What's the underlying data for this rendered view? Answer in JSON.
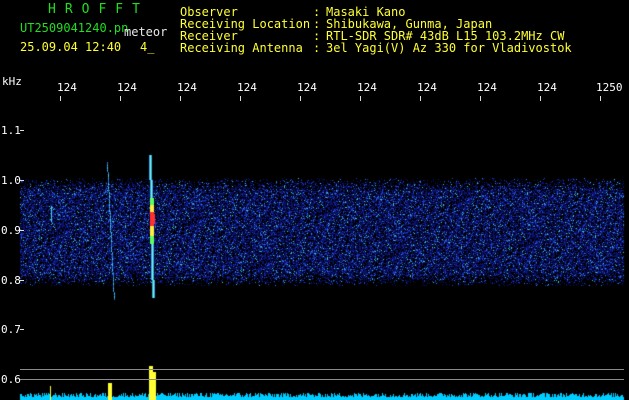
{
  "header": {
    "brand": "HROFFT",
    "filename": "UT2509041240.pn",
    "mode": "meteor",
    "datetime": "25.09.04 12:40",
    "count": "4_",
    "fields": [
      {
        "label": "Observer",
        "value": "Masaki Kano"
      },
      {
        "label": "Receiving Location",
        "value": "Shibukawa, Gunma, Japan"
      },
      {
        "label": "Receiver",
        "value": "RTL-SDR SDR# 43dB L15 103.2MHz CW"
      },
      {
        "label": "Receiving Antenna",
        "value": "3el Yagi(V) Az 330 for Vladivostok"
      }
    ],
    "sep": ":"
  },
  "axis": {
    "unit": "kHz",
    "x_ticks": [
      "124",
      "124",
      "124",
      "124",
      "124",
      "124",
      "124",
      "124",
      "124",
      "1250"
    ],
    "y_ticks": [
      "1.1",
      "1.0",
      "0.9",
      "0.8",
      "0.7",
      "0.6"
    ]
  },
  "colors": {
    "green": "#22dd22",
    "yellow": "#ffff33",
    "noise": "#1a2a9a",
    "signal_bar": "#00ccff"
  }
}
